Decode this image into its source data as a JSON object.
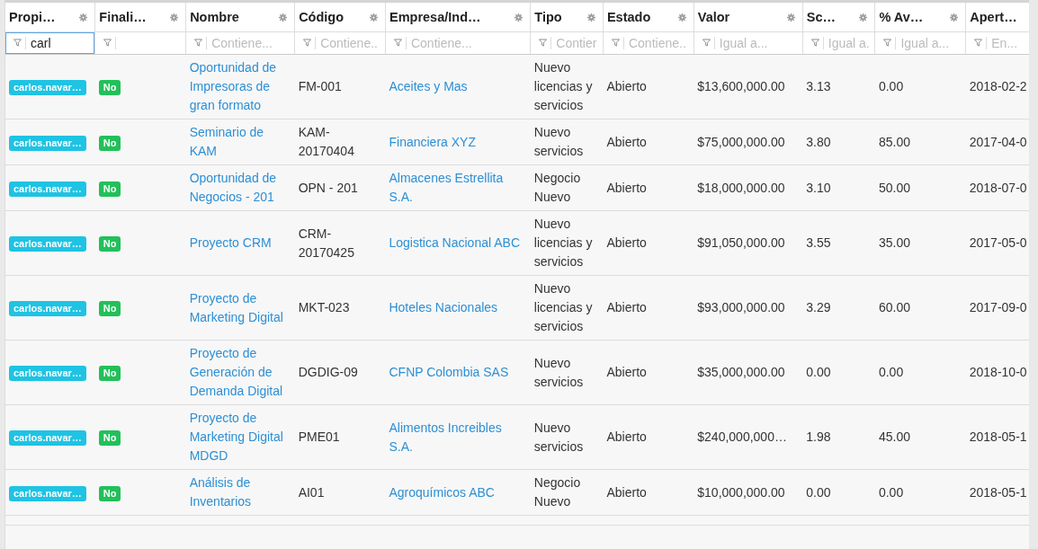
{
  "columns": [
    {
      "label": "Propi…",
      "filter": {
        "value": "carl",
        "focused": true
      }
    },
    {
      "label": "Finali…",
      "filter": {
        "focused": false
      }
    },
    {
      "label": "Nombre",
      "filter": {
        "placeholder": "Contiene...",
        "focused": false
      }
    },
    {
      "label": "Código",
      "filter": {
        "placeholder": "Contiene..",
        "focused": false
      }
    },
    {
      "label": "Empresa/Ind…",
      "filter": {
        "placeholder": "Contiene...",
        "focused": false
      }
    },
    {
      "label": "Tipo",
      "filter": {
        "placeholder": "Contier",
        "focused": false
      }
    },
    {
      "label": "Estado",
      "filter": {
        "placeholder": "Contiene..",
        "focused": false
      }
    },
    {
      "label": "Valor",
      "filter": {
        "placeholder": "Igual a...",
        "focused": false
      }
    },
    {
      "label": "Sc…",
      "filter": {
        "placeholder": "Igual a.",
        "focused": false
      }
    },
    {
      "label": "% Av…",
      "filter": {
        "placeholder": "Igual a...",
        "focused": false
      }
    },
    {
      "label": "Apert…",
      "filter": {
        "placeholder": "En...",
        "focused": false
      }
    }
  ],
  "rows": [
    {
      "owner": "carlos.navar…",
      "closed": "No",
      "name": "Oportunidad de Impresoras de gran formato",
      "code": "FM-001",
      "company": "Aceites y Mas",
      "type": "Nuevo licencias y servicios",
      "status": "Abierto",
      "value": "$13,600,000.00",
      "score": "3.13",
      "progress": "0.00",
      "opened": "2018-02-2"
    },
    {
      "owner": "carlos.navar…",
      "closed": "No",
      "name": "Seminario de KAM",
      "code": "KAM-20170404",
      "company": "Financiera XYZ",
      "type": "Nuevo servicios",
      "status": "Abierto",
      "value": "$75,000,000.00",
      "score": "3.80",
      "progress": "85.00",
      "opened": "2017-04-0"
    },
    {
      "owner": "carlos.navar…",
      "closed": "No",
      "name": "Oportunidad de Negocios - 201",
      "code": "OPN - 201",
      "company": "Almacenes Estrellita S.A.",
      "type": "Negocio Nuevo",
      "status": "Abierto",
      "value": "$18,000,000.00",
      "score": "3.10",
      "progress": "50.00",
      "opened": "2018-07-0"
    },
    {
      "owner": "carlos.navar…",
      "closed": "No",
      "name": "Proyecto CRM",
      "code": "CRM-20170425",
      "company": "Logistica Nacional ABC",
      "type": "Nuevo licencias y servicios",
      "status": "Abierto",
      "value": "$91,050,000.00",
      "score": "3.55",
      "progress": "35.00",
      "opened": "2017-05-0"
    },
    {
      "owner": "carlos.navar…",
      "closed": "No",
      "name": "Proyecto de Marketing Digital",
      "code": "MKT-023",
      "company": "Hoteles Nacionales",
      "type": "Nuevo licencias y servicios",
      "status": "Abierto",
      "value": "$93,000,000.00",
      "score": "3.29",
      "progress": "60.00",
      "opened": "2017-09-0"
    },
    {
      "owner": "carlos.navar…",
      "closed": "No",
      "name": "Proyecto de Generación de Demanda Digital",
      "code": "DGDIG-09",
      "company": "CFNP Colombia SAS",
      "type": "Nuevo servicios",
      "status": "Abierto",
      "value": "$35,000,000.00",
      "score": "0.00",
      "progress": "0.00",
      "opened": "2018-10-0"
    },
    {
      "owner": "carlos.navar…",
      "closed": "No",
      "name": "Proyecto de Marketing Digital MDGD",
      "code": "PME01",
      "company": "Alimentos Increibles S.A.",
      "type": "Nuevo servicios",
      "status": "Abierto",
      "value": "$240,000,000…",
      "score": "1.98",
      "progress": "45.00",
      "opened": "2018-05-1"
    },
    {
      "owner": "carlos.navar…",
      "closed": "No",
      "name": "Análisis de Inventarios",
      "code": "AI01",
      "company": "Agroquímicos ABC",
      "type": "Negocio Nuevo",
      "status": "Abierto",
      "value": "$10,000,000.00",
      "score": "0.00",
      "progress": "0.00",
      "opened": "2018-05-1"
    }
  ]
}
